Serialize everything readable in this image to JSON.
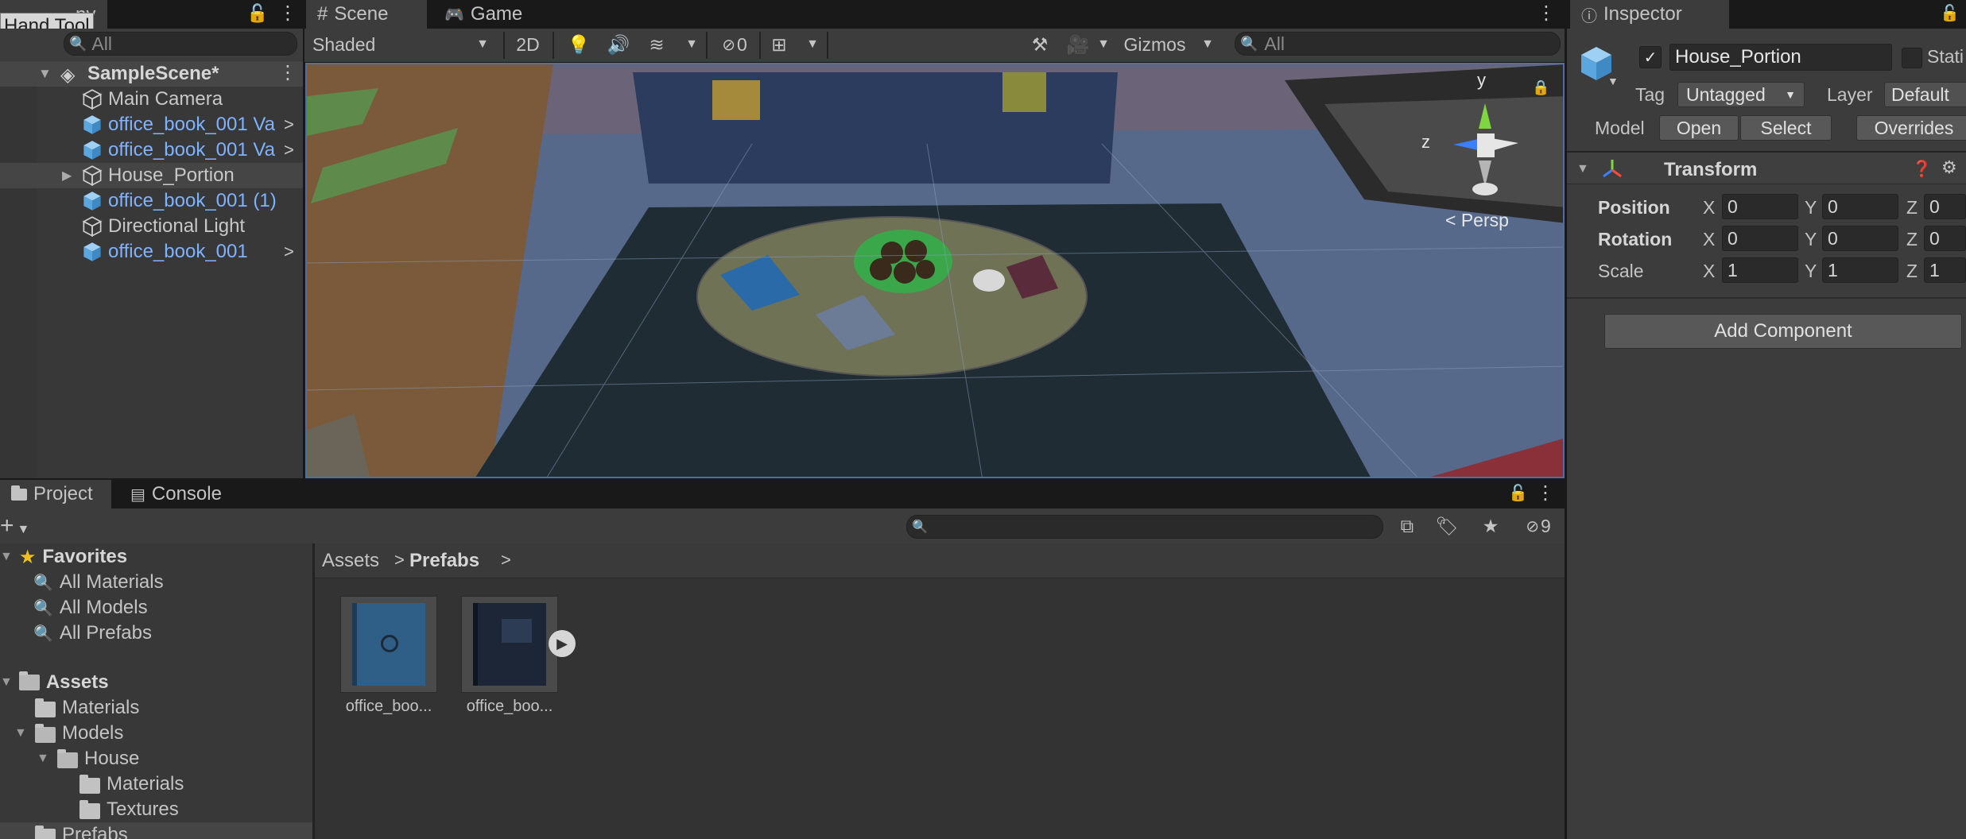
{
  "hierarchy": {
    "tab_label": "ny",
    "tooltip": "Hand Tool",
    "search_placeholder": "All",
    "scene_name": "SampleScene*",
    "items": [
      {
        "label": "Main Camera",
        "blue": false,
        "arrow": false,
        "expand": false
      },
      {
        "label": "office_book_001 Va",
        "blue": true,
        "arrow": true,
        "expand": false
      },
      {
        "label": "office_book_001 Va",
        "blue": true,
        "arrow": true,
        "expand": false
      },
      {
        "label": "House_Portion",
        "blue": false,
        "arrow": false,
        "expand": true
      },
      {
        "label": "office_book_001 (1)",
        "blue": true,
        "arrow": false,
        "expand": false
      },
      {
        "label": "Directional Light",
        "blue": false,
        "arrow": false,
        "expand": false
      },
      {
        "label": "office_book_001",
        "blue": true,
        "arrow": true,
        "expand": false
      }
    ]
  },
  "scene": {
    "tab_scene": "Scene",
    "tab_game": "Game",
    "shading_mode": "Shaded",
    "mode_2d": "2D",
    "hidden_count": "0",
    "gizmos": "Gizmos",
    "search_placeholder": "All",
    "persp_label": "< Persp",
    "axis_y": "y",
    "axis_z": "z"
  },
  "project": {
    "tab_project": "Project",
    "tab_console": "Console",
    "hidden_count": "9",
    "breadcrumb": [
      "Assets",
      "Prefabs"
    ],
    "favorites_label": "Favorites",
    "favorites": [
      "All Materials",
      "All Models",
      "All Prefabs"
    ],
    "assets_label": "Assets",
    "tree": [
      {
        "label": "Materials",
        "indent": 1,
        "arrow": "",
        "open": false
      },
      {
        "label": "Models",
        "indent": 1,
        "arrow": "▼",
        "open": true
      },
      {
        "label": "House",
        "indent": 2,
        "arrow": "▼",
        "open": true
      },
      {
        "label": "Materials",
        "indent": 3,
        "arrow": "",
        "open": false
      },
      {
        "label": "Textures",
        "indent": 3,
        "arrow": "",
        "open": false
      },
      {
        "label": "Prefabs",
        "indent": 1,
        "arrow": "",
        "open": false
      }
    ],
    "assets": [
      {
        "name": "office_boo..."
      },
      {
        "name": "office_boo..."
      }
    ]
  },
  "inspector": {
    "tab_label": "Inspector",
    "object_name": "House_Portion",
    "static_label": "Stati",
    "tag_label": "Tag",
    "tag_value": "Untagged",
    "layer_label": "Layer",
    "layer_value": "Default",
    "model_label": "Model",
    "open_label": "Open",
    "select_label": "Select",
    "overrides_label": "Overrides",
    "transform_title": "Transform",
    "rows": [
      {
        "label": "Position",
        "x": "0",
        "y": "0",
        "z": "0"
      },
      {
        "label": "Rotation",
        "x": "0",
        "y": "0",
        "z": "0"
      },
      {
        "label": "Scale",
        "x": "1",
        "y": "1",
        "z": "1"
      }
    ],
    "axis_x": "X",
    "axis_y": "Y",
    "axis_z": "Z",
    "add_component": "Add Component"
  }
}
